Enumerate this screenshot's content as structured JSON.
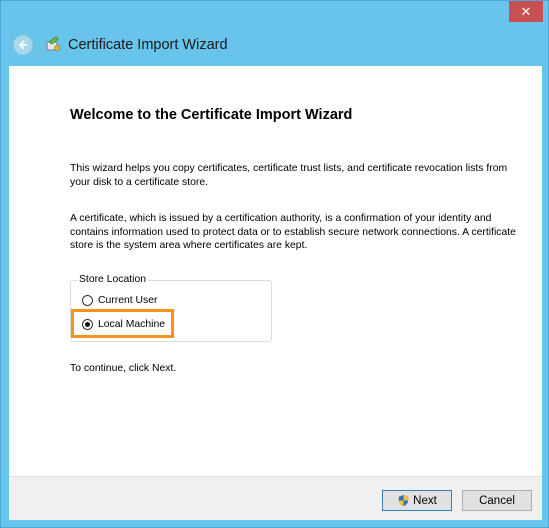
{
  "window": {
    "title": "Certificate Import Wizard",
    "close_glyph": "✕"
  },
  "main": {
    "heading": "Welcome to the Certificate Import Wizard",
    "para1": "This wizard helps you copy certificates, certificate trust lists, and certificate revocation lists from your disk to a certificate store.",
    "para2": "A certificate, which is issued by a certification authority, is a confirmation of your identity and contains information used to protect data or to establish secure network connections. A certificate store is the system area where certificates are kept.",
    "store_location": {
      "legend": "Store Location",
      "options": [
        {
          "label": "Current User",
          "selected": false
        },
        {
          "label": "Local Machine",
          "selected": true
        }
      ]
    },
    "continue_text": "To continue, click Next."
  },
  "footer": {
    "next_label": "Next",
    "cancel_label": "Cancel"
  },
  "colors": {
    "titlebar": "#69c4eb",
    "close": "#c75050",
    "highlight": "#f7921e"
  },
  "icons": [
    "close-icon",
    "back-arrow-icon",
    "certificate-wizard-icon",
    "shield-icon"
  ]
}
